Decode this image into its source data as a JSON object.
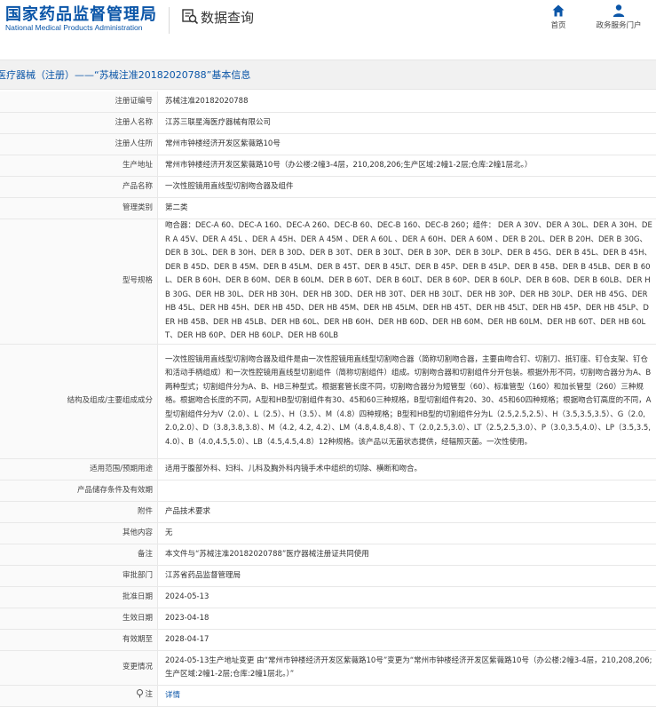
{
  "header": {
    "logo_cn": "国家药品监督管理局",
    "logo_en": "National Medical Products Administration",
    "search_title": "数据查询",
    "nav": [
      {
        "label": "首页",
        "icon": "home-icon"
      },
      {
        "label": "政务服务门户",
        "icon": "user-icon"
      }
    ]
  },
  "title": "医疗器械（注册）——“苏械注准20182020788”基本信息",
  "rows": [
    {
      "label": "注册证编号",
      "value": "苏械注准20182020788"
    },
    {
      "label": "注册人名称",
      "value": "江苏三联星海医疗器械有限公司"
    },
    {
      "label": "注册人住所",
      "value": "常州市钟楼经济开发区紫薇路10号"
    },
    {
      "label": "生产地址",
      "value": "常州市钟楼经济开发区紫薇路10号（办公楼:2幢3-4层，210,208,206;生产区域:2幢1-2层;仓库:2幢1层北。）"
    },
    {
      "label": "产品名称",
      "value": "一次性腔镜用直线型切割吻合器及组件"
    },
    {
      "label": "管理类别",
      "value": "第二类"
    },
    {
      "label": "型号规格",
      "value": "吻合器：DEC-A 60、DEC-A 160、DEC-A 260、DEC-B 60、DEC-B 160、DEC-B 260；组件： DER A 30V、DER A 30L、DER A 30H、DER A 45V、DER A 45L 、DER A 45H、DER A 45M 、DER A 60L 、DER A 60H、DER A 60M 、DER B 20L、DER B 20H、DER B 30G、DER B 30L、DER B 30H、DER B 30D、DER B 30T、DER B 30LT、DER B 30P、DER B 30LP、DER B 45G、DER B 45L、DER B 45H、DER B 45D、DER B 45M、DER B 45LM、DER B 45T、DER B 45LT、DER B 45P、DER B 45LP、DER B 45B、DER B 45LB、DER B 60L、DER B 60H、DER B 60M、DER B 60LM、DER B 60T、DER B 60LT、DER B 60P、DER B 60LP、DER B 60B、DER B 60LB、DER HB 30G、DER HB 30L、DER HB 30H、DER HB 30D、DER HB 30T、DER HB 30LT、DER HB 30P、DER HB 30LP、DER HB 45G、DER HB 45L、DER HB 45H、DER HB 45D、DER HB 45M、DER HB 45LM、DER HB 45T、DER HB 45LT、DER HB 45P、DER HB 45LP、DER HB 45B、DER HB 45LB、DER HB 60L、DER HB 60H、DER HB 60D、DER HB 60M、DER HB 60LM、DER HB 60T、DER HB 60LT、DER HB 60P、DER HB 60LP、DER HB 60LB"
    },
    {
      "label": "结构及组成/主要组成成分",
      "value": "一次性腔镜用直线型切割吻合器及组件是由一次性腔镜用直线型切割吻合器（简称切割吻合器，主要由吻合钉、切割刀、抵钉座、钉仓支架、钉仓和活动手柄组成）和一次性腔镜用直线型切割组件（简称切割组件）组成。切割吻合器和切割组件分开包装。根据外形不同，切割吻合器分为A、B两种型式；切割组件分为A、B、HB三种型式。根据套管长度不同，切割吻合器分为短管型（60）、标准管型（160）和加长管型（260）三种规格。根据吻合长度的不同，A型和HB型切割组件有30、45和60三种规格，B型切割组件有20、30、45和60四种规格；根据吻合钉高度的不同，A型切割组件分为V（2.0）、L（2.5）、H（3.5）、M（4.8）四种规格；B型和HB型的切割组件分为L（2.5,2.5,2.5）、H（3.5,3.5,3.5）、G（2.0,2.0,2.0）、D（3.8,3.8,3.8）、M（4.2, 4.2, 4.2）、LM（4.8,4.8,4.8）、T（2.0,2.5,3.0）、LT（2.5,2.5,3.0）、P（3.0,3.5,4.0）、LP（3.5,3.5,4.0）、B（4.0,4.5,5.0）、LB（4.5,4.5,4.8）12种规格。该产品以无菌状态提供，经辐照灭菌。一次性使用。"
    },
    {
      "label": "适用范围/预期用途",
      "value": "适用于腹部外科、妇科、儿科及胸外科内镜手术中组织的切除、横断和吻合。"
    },
    {
      "label": "产品储存条件及有效期",
      "value": ""
    },
    {
      "label": "附件",
      "value": "产品技术要求"
    },
    {
      "label": "其他内容",
      "value": "无"
    },
    {
      "label": "备注",
      "value": "本文件与“苏械注准20182020788”医疗器械注册证共同使用"
    },
    {
      "label": "审批部门",
      "value": "江苏省药品监督管理局"
    },
    {
      "label": "批准日期",
      "value": "2024-05-13"
    },
    {
      "label": "生效日期",
      "value": "2023-04-18"
    },
    {
      "label": "有效期至",
      "value": "2028-04-17"
    },
    {
      "label": "变更情况",
      "value": "2024-05-13生产地址变更 由“常州市钟楼经济开发区紫薇路10号”变更为“常州市钟楼经济开发区紫薇路10号（办公楼:2幢3-4层，210,208,206;生产区域:2幢1-2层;仓库:2幢1层北。）”"
    },
    {
      "label": "注",
      "value": "详情",
      "is_link": true
    }
  ],
  "colors": {
    "brand_blue": "#0b56a8",
    "title_bg": "#f1f1f1",
    "label_bg": "#fafafa"
  }
}
